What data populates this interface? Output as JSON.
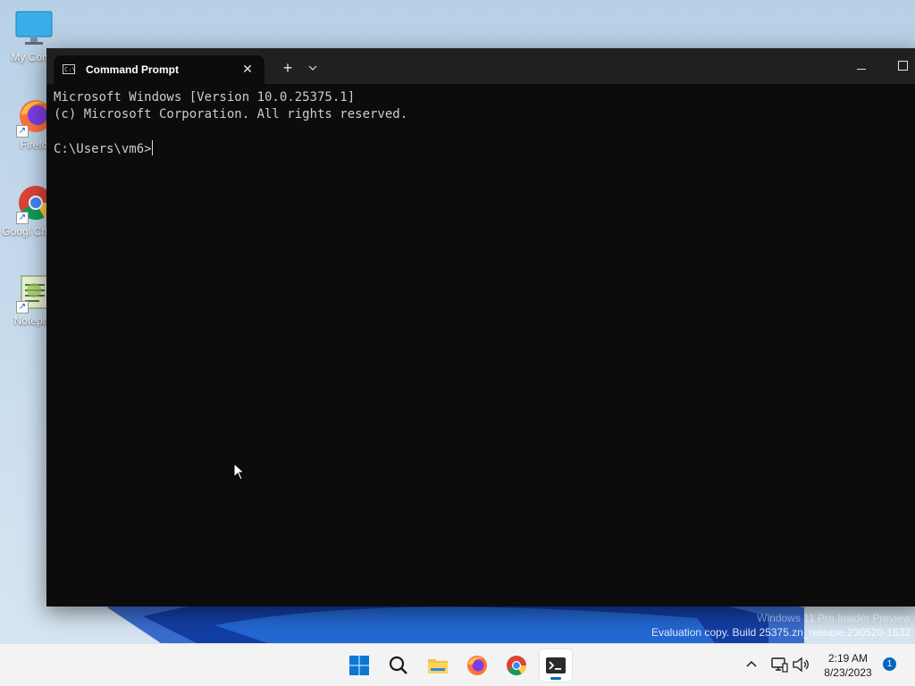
{
  "desktop": {
    "icons": [
      {
        "label": "My Comp",
        "icon": "computer-icon"
      },
      {
        "label": "Firefo",
        "icon": "firefox-icon"
      },
      {
        "label": "Googl Chrom",
        "icon": "chrome-icon"
      },
      {
        "label": "Notepac",
        "icon": "notepad-icon"
      }
    ],
    "watermark": {
      "line1": "Windows 11 Pro Insider Preview",
      "line2": "Evaluation copy. Build 25375.zn_release.230520-1632"
    }
  },
  "terminal": {
    "tab_title": "Command Prompt",
    "tab_close": "✕",
    "new_tab": "+",
    "dropdown": "⌄",
    "minimize": "—",
    "lines": [
      "Microsoft Windows [Version 10.0.25375.1]",
      "(c) Microsoft Corporation. All rights reserved.",
      "",
      "C:\\Users\\vm6>"
    ]
  },
  "taskbar": {
    "items": [
      "start-icon",
      "search-icon",
      "file-explorer-icon",
      "firefox-icon",
      "chrome-icon",
      "terminal-icon"
    ],
    "active": "terminal-icon",
    "clock": {
      "time": "2:19 AM",
      "date": "8/23/2023"
    },
    "notification_count": "1"
  },
  "colors": {
    "console_bg": "#0c0c0c",
    "titlebar_bg": "#202020",
    "accent": "#0067c0"
  }
}
